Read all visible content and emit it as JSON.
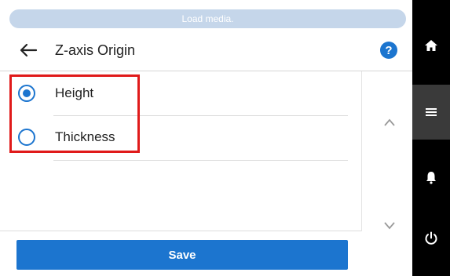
{
  "status": {
    "text": "Load media."
  },
  "header": {
    "title": "Z-axis Origin",
    "help_label": "?"
  },
  "options": [
    {
      "label": "Height",
      "selected": true
    },
    {
      "label": "Thickness",
      "selected": false
    }
  ],
  "footer": {
    "save_label": "Save"
  },
  "nav": {
    "items": [
      "home-icon",
      "menu-icon",
      "bell-icon",
      "power-icon"
    ]
  },
  "colors": {
    "accent": "#1c75cf",
    "highlight": "#e01a1a",
    "nav_bg": "#000000",
    "status_bg": "#c5d6ea"
  }
}
